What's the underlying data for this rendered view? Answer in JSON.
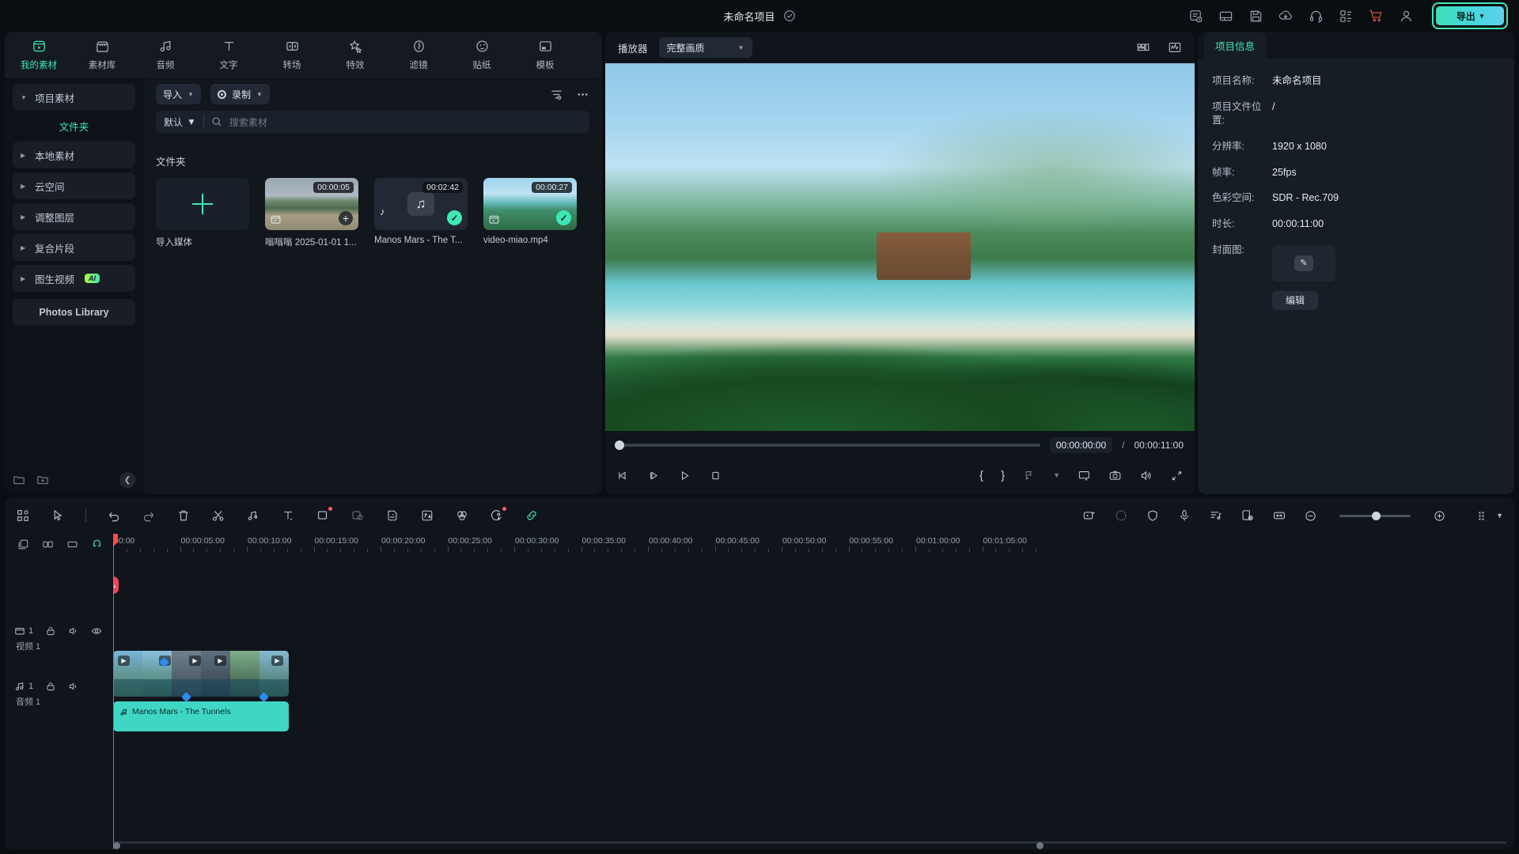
{
  "topbar": {
    "project_title": "未命名项目",
    "icons": [
      "project-notes-icon",
      "layout-icon",
      "save-icon",
      "cloud-upload-icon",
      "headset-support-icon",
      "apps-grid-icon",
      "shopping-cart-icon",
      "account-icon"
    ],
    "export_label": "导出"
  },
  "tabs": [
    {
      "label": "我的素材",
      "icon": "my-media-icon",
      "active": true
    },
    {
      "label": "素材库",
      "icon": "stock-library-icon",
      "active": false
    },
    {
      "label": "音频",
      "icon": "audio-icon",
      "active": false
    },
    {
      "label": "文字",
      "icon": "text-icon",
      "active": false
    },
    {
      "label": "转场",
      "icon": "transition-icon",
      "active": false
    },
    {
      "label": "特效",
      "icon": "effects-icon",
      "active": false
    },
    {
      "label": "滤镜",
      "icon": "filter-icon",
      "active": false
    },
    {
      "label": "贴纸",
      "icon": "sticker-icon",
      "active": false
    },
    {
      "label": "模板",
      "icon": "template-icon",
      "active": false
    }
  ],
  "sidebar": {
    "items": [
      {
        "label": "项目素材",
        "expanded": true
      },
      {
        "label": "本地素材",
        "expanded": false
      },
      {
        "label": "云空间",
        "expanded": false
      },
      {
        "label": "调整图层",
        "expanded": false
      },
      {
        "label": "复合片段",
        "expanded": false
      },
      {
        "label": "图生视频",
        "expanded": false,
        "badge": "AI"
      }
    ],
    "sub_label": "文件夹",
    "photos_library": "Photos Library"
  },
  "media": {
    "import_label": "导入",
    "record_label": "录制",
    "sort_label": "默认",
    "search_placeholder": "搜索素材",
    "section_title": "文件夹",
    "items": [
      {
        "name": "导入媒体",
        "type": "import",
        "duration": ""
      },
      {
        "name": "嗡嗡嗡 2025-01-01 1...",
        "type": "video",
        "duration": "00:00:05",
        "selected": false
      },
      {
        "name": "Manos Mars - The T...",
        "type": "audio",
        "duration": "00:02:42",
        "selected": true
      },
      {
        "name": "video-miao.mp4",
        "type": "video",
        "duration": "00:00:27",
        "selected": true
      }
    ]
  },
  "player": {
    "label": "播放器",
    "quality": "完整画质",
    "current_time": "00:00:00:00",
    "separator": "/",
    "total_time": "00:00:11:00",
    "mark_in": "{",
    "mark_out": "}"
  },
  "project_info": {
    "tab_label": "项目信息",
    "rows": [
      {
        "key": "项目名称:",
        "value": "未命名项目"
      },
      {
        "key": "项目文件位置:",
        "value": "/"
      },
      {
        "key": "分辨率:",
        "value": "1920 x 1080"
      },
      {
        "key": "帧率:",
        "value": "25fps"
      },
      {
        "key": "色彩空间:",
        "value": "SDR - Rec.709"
      },
      {
        "key": "时长:",
        "value": "00:00:11:00"
      },
      {
        "key": "封面图:",
        "value": ""
      }
    ],
    "edit_label": "编辑"
  },
  "timeline": {
    "ruler_labels": [
      "00:00",
      "00:00:05:00",
      "00:00:10:00",
      "00:00:15:00",
      "00:00:20:00",
      "00:00:25:00",
      "00:00:30:00",
      "00:00:35:00",
      "00:00:40:00",
      "00:00:45:00",
      "00:00:50:00",
      "00:00:55:00",
      "00:01:00:00",
      "00:01:05:00"
    ],
    "tracks": [
      {
        "index": "1",
        "name": "视频 1",
        "type": "video"
      },
      {
        "index": "1",
        "name": "音频 1",
        "type": "audio"
      }
    ],
    "audio_clip_label": "Manos Mars - The Tunnels",
    "zoom_level": 46
  },
  "colors": {
    "accent": "#3ee8b5",
    "playhead": "#ff4d4d",
    "selection": "#4ab8f5",
    "audio_clip": "#3fd6c4"
  }
}
